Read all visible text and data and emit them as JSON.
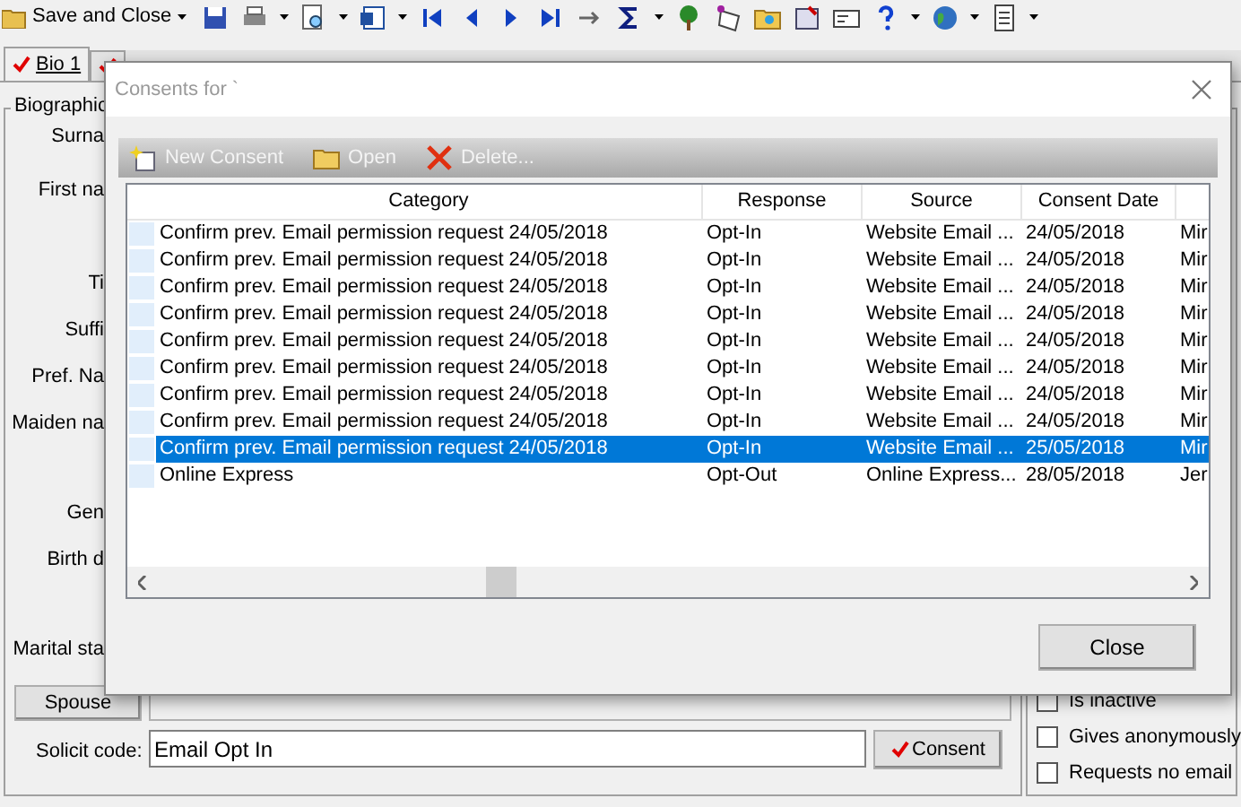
{
  "toolbar": {
    "save_label": "Save and Close"
  },
  "tabs": [
    {
      "label": "Bio 1",
      "selected": true,
      "checked": true
    },
    {
      "selected": false,
      "checked": true
    }
  ],
  "group": {
    "title": "Biographic",
    "labels": [
      "Surna",
      "First na",
      "Ti",
      "Suffi",
      "Pref. Na",
      "Maiden na",
      "Gen",
      "Birth d",
      "Marital sta"
    ]
  },
  "spouse": {
    "label": "Spouse"
  },
  "solicit": {
    "label": "Solicit code:",
    "value": "Email Opt In",
    "button": "Consent",
    "checked": true
  },
  "options": [
    {
      "label": "Is inactive",
      "checked": false
    },
    {
      "label": "Gives anonymously",
      "checked": false
    },
    {
      "label": "Requests no email",
      "checked": false
    }
  ],
  "dialog": {
    "title": "Consents for `",
    "toolbar": [
      {
        "kind": "new",
        "label": "New Consent",
        "disabled": true
      },
      {
        "kind": "open",
        "label": "Open",
        "disabled": true
      },
      {
        "kind": "delete",
        "label": "Delete...",
        "disabled": true
      }
    ],
    "columns": [
      "Category",
      "Response",
      "Source",
      "Consent Date"
    ],
    "rows": [
      {
        "cells": [
          "Confirm prev. Email permission request 24/05/2018",
          "Opt-In",
          "Website Email ...",
          "24/05/2018",
          "Mir"
        ],
        "selected": false
      },
      {
        "cells": [
          "Confirm prev. Email permission request 24/05/2018",
          "Opt-In",
          "Website Email ...",
          "24/05/2018",
          "Mir"
        ],
        "selected": false
      },
      {
        "cells": [
          "Confirm prev. Email permission request 24/05/2018",
          "Opt-In",
          "Website Email ...",
          "24/05/2018",
          "Mir"
        ],
        "selected": false
      },
      {
        "cells": [
          "Confirm prev. Email permission request 24/05/2018",
          "Opt-In",
          "Website Email ...",
          "24/05/2018",
          "Mir"
        ],
        "selected": false
      },
      {
        "cells": [
          "Confirm prev. Email permission request 24/05/2018",
          "Opt-In",
          "Website Email ...",
          "24/05/2018",
          "Mir"
        ],
        "selected": false
      },
      {
        "cells": [
          "Confirm prev. Email permission request 24/05/2018",
          "Opt-In",
          "Website Email ...",
          "24/05/2018",
          "Mir"
        ],
        "selected": false
      },
      {
        "cells": [
          "Confirm prev. Email permission request 24/05/2018",
          "Opt-In",
          "Website Email ...",
          "24/05/2018",
          "Mir"
        ],
        "selected": false
      },
      {
        "cells": [
          "Confirm prev. Email permission request 24/05/2018",
          "Opt-In",
          "Website Email ...",
          "24/05/2018",
          "Mir"
        ],
        "selected": false
      },
      {
        "cells": [
          "Confirm prev. Email permission request 24/05/2018",
          "Opt-In",
          "Website Email ...",
          "25/05/2018",
          "Mir"
        ],
        "selected": true
      },
      {
        "cells": [
          "Online Express",
          "Opt-Out",
          "Online Express...",
          "28/05/2018",
          "Jer"
        ],
        "selected": false
      }
    ],
    "close_button": "Close"
  }
}
